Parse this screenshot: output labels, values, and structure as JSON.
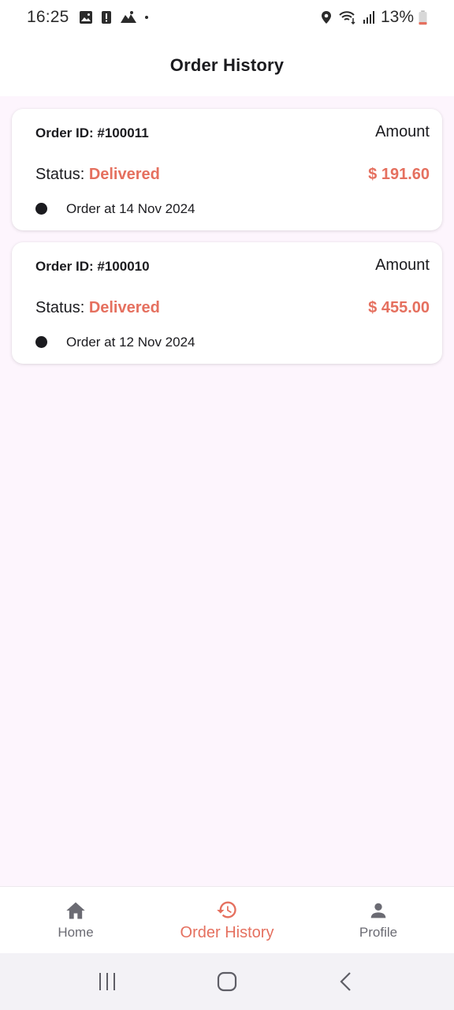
{
  "status_bar": {
    "time": "16:25",
    "battery": "13%",
    "left_icons": [
      "image-icon",
      "alert-icon",
      "hiking-icon",
      "dot-icon"
    ],
    "right_icons": [
      "location-icon",
      "wifi-icon",
      "signal-icon",
      "battery-icon"
    ]
  },
  "app_bar": {
    "title": "Order History"
  },
  "orders": [
    {
      "id_text": "Order ID: #100011",
      "amount_label": "Amount",
      "status_label": "Status: ",
      "status_value": "Delivered",
      "amount_value": "$ 191.60",
      "date_text": "Order at 14 Nov 2024"
    },
    {
      "id_text": "Order ID: #100010",
      "amount_label": "Amount",
      "status_label": "Status: ",
      "status_value": "Delivered",
      "amount_value": "$ 455.00",
      "date_text": "Order at 12 Nov 2024"
    }
  ],
  "bottom_nav": {
    "items": [
      {
        "label": "Home",
        "icon": "home-icon",
        "active": false
      },
      {
        "label": "Order History",
        "icon": "history-icon",
        "active": true
      },
      {
        "label": "Profile",
        "icon": "person-icon",
        "active": false
      }
    ]
  },
  "colors": {
    "accent": "#e5705f",
    "background": "#fdf5fd",
    "card": "#ffffff",
    "text": "#1b1b1f",
    "inactive": "#6b6b73"
  },
  "system_nav": {
    "buttons": [
      "recents-icon",
      "home-circle-icon",
      "back-icon"
    ]
  }
}
